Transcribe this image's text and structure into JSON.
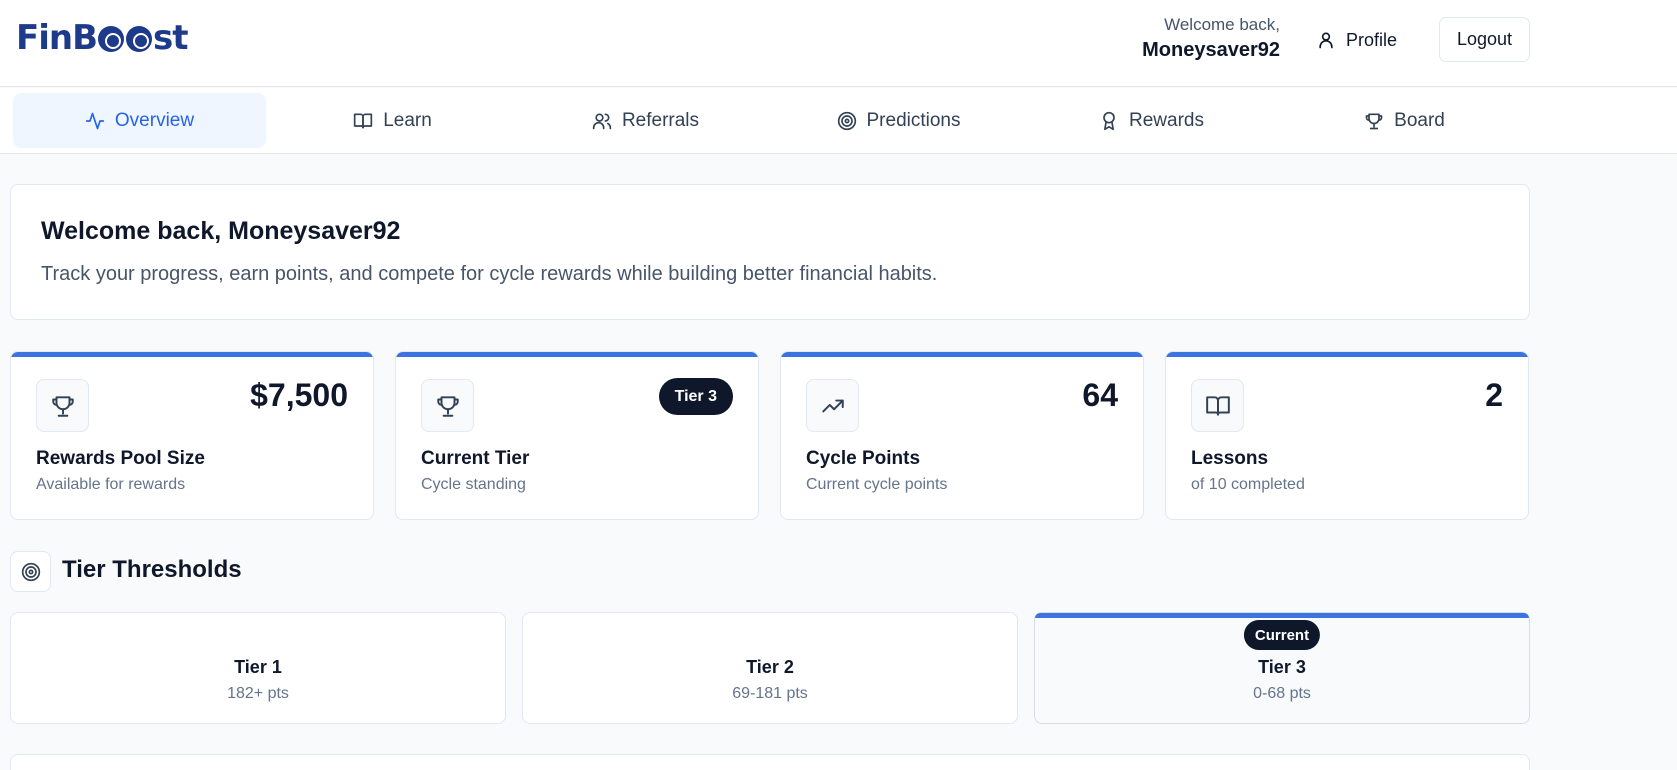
{
  "header": {
    "logo": "FinBoost",
    "welcome_small": "Welcome back,",
    "username": "Moneysaver92",
    "profile_label": "Profile",
    "logout_label": "Logout"
  },
  "nav": {
    "tabs": [
      {
        "label": "Overview",
        "icon": "activity-icon",
        "active": true
      },
      {
        "label": "Learn",
        "icon": "book-icon"
      },
      {
        "label": "Referrals",
        "icon": "users-icon"
      },
      {
        "label": "Predictions",
        "icon": "target-icon"
      },
      {
        "label": "Rewards",
        "icon": "award-icon"
      },
      {
        "label": "Board",
        "icon": "trophy-icon"
      }
    ]
  },
  "welcome": {
    "title": "Welcome back, Moneysaver92",
    "subtitle": "Track your progress, earn points, and compete for cycle rewards while building better financial habits."
  },
  "stats": [
    {
      "icon": "trophy-icon",
      "value": "$7,500",
      "label": "Rewards Pool Size",
      "sub": "Available for rewards"
    },
    {
      "icon": "trophy-icon",
      "badge": "Tier 3",
      "label": "Current Tier",
      "sub": "Cycle standing"
    },
    {
      "icon": "trending-up-icon",
      "value": "64",
      "label": "Cycle Points",
      "sub": "Current cycle points"
    },
    {
      "icon": "book-icon",
      "value": "2",
      "label": "Lessons",
      "sub": "of 10 completed"
    }
  ],
  "tiers": {
    "title": "Tier Thresholds",
    "icon": "target-icon",
    "items": [
      {
        "name": "Tier 1",
        "pts": "182+ pts"
      },
      {
        "name": "Tier 2",
        "pts": "69-181 pts"
      },
      {
        "name": "Tier 3",
        "pts": "0-68 pts",
        "current": true,
        "badge": "Current"
      }
    ]
  },
  "colors": {
    "accent": "#3b73e0",
    "active_tab_bg": "#eff6ff",
    "active_tab_text": "#2563eb",
    "brand": "#1e3a8a",
    "badge_bg": "#0f172a"
  }
}
